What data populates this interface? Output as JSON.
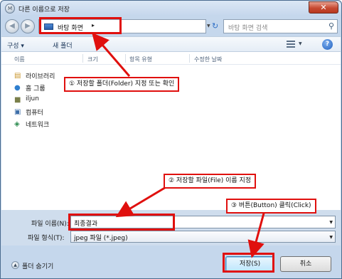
{
  "window": {
    "title": "다른 이름으로 저장",
    "close_label": "✕"
  },
  "nav": {
    "back_label": "◀",
    "forward_label": "▶",
    "address": "바탕 화면",
    "address_arrow": "▸",
    "search_placeholder": "바탕 화면 검색"
  },
  "toolbar": {
    "organize": "구성 ▾",
    "new_folder": "새 폴더"
  },
  "columns": [
    "이름",
    "크기",
    "항목 유형",
    "수정한 날짜"
  ],
  "tree": [
    {
      "label": "라이브러리",
      "icon": "library-icon"
    },
    {
      "label": "홈 그룹",
      "icon": "homegroup-icon"
    },
    {
      "label": "iljun",
      "icon": "user-folder-icon"
    },
    {
      "label": "컴퓨터",
      "icon": "computer-icon"
    },
    {
      "label": "네트워크",
      "icon": "network-icon"
    }
  ],
  "fields": {
    "filename_label": "파일 이름(N):",
    "filename_value": "최종결과",
    "filetype_label": "파일 형식(T):",
    "filetype_value": "jpeg 파일 (*.jpeg)"
  },
  "bottom": {
    "hide_folders": "폴더 숨기기",
    "save": "저장(S)",
    "cancel": "취소"
  },
  "annotations": {
    "step1": "① 저장할 폴더(Folder) 지정 또는 확인",
    "step2": "② 저장할 파일(File) 이름 지정",
    "step3": "③ 버튼(Button) 클릭(Click)"
  },
  "colors": {
    "annotation": "#e0100e",
    "window_chrome": "#c5d7ec"
  }
}
